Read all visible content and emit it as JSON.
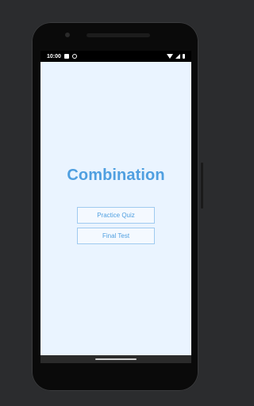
{
  "status_bar": {
    "time": "10:00"
  },
  "app": {
    "title": "Combination",
    "buttons": {
      "practice_quiz": "Practice Quiz",
      "final_test": "Final Test"
    }
  },
  "colors": {
    "accent": "#4f9fe0",
    "app_background": "#eaf4ff",
    "button_border": "#9fcaf0",
    "outer_background": "#2b2c2e"
  }
}
